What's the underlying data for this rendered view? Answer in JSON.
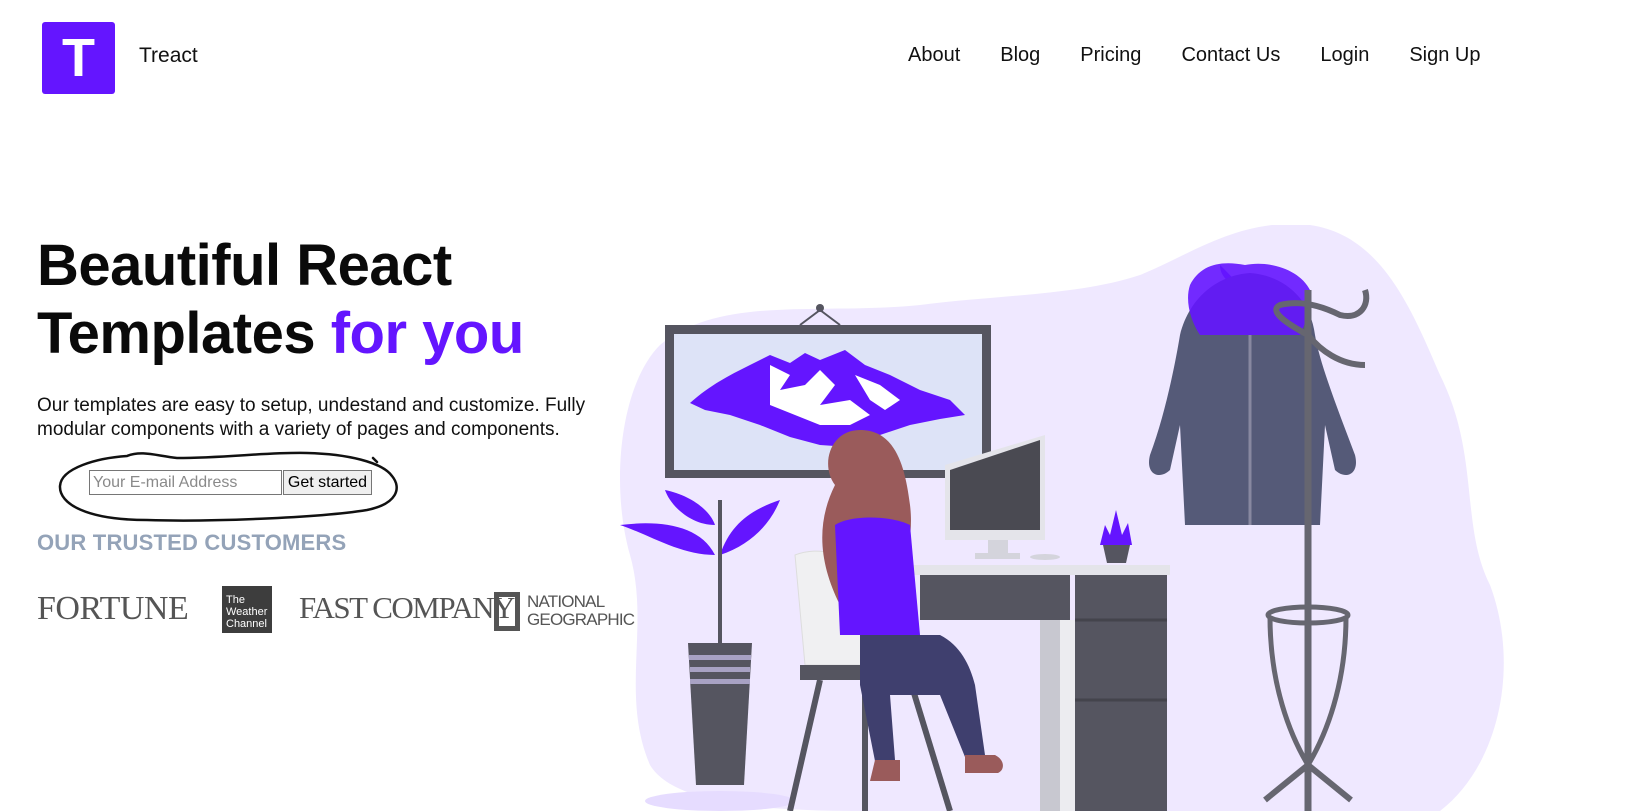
{
  "header": {
    "logo_letter": "T",
    "brand": "Treact",
    "nav": [
      "About",
      "Blog",
      "Pricing",
      "Contact Us",
      "Login",
      "Sign Up"
    ]
  },
  "hero": {
    "headline_line1": "Beautiful React",
    "headline_line2_plain": "Templates ",
    "headline_line2_accent": "for you",
    "description": "Our templates are easy to setup, undestand and customize. Fully modular components with a variety of pages and components.",
    "email_placeholder": "Your E-mail Address",
    "cta_label": "Get started"
  },
  "customers": {
    "heading": "OUR TRUSTED CUSTOMERS",
    "logos": {
      "fortune": "FORTUNE",
      "weather_channel": [
        "The",
        "Weather",
        "Channel"
      ],
      "fast_company": "FAST COMPANY",
      "national_geographic": [
        "NATIONAL",
        "GEOGRAPHIC"
      ]
    }
  },
  "colors": {
    "primary": "#6415ff",
    "muted": "#94a3b8",
    "blob": "#efe8ff",
    "dark_furniture": "#555560"
  }
}
